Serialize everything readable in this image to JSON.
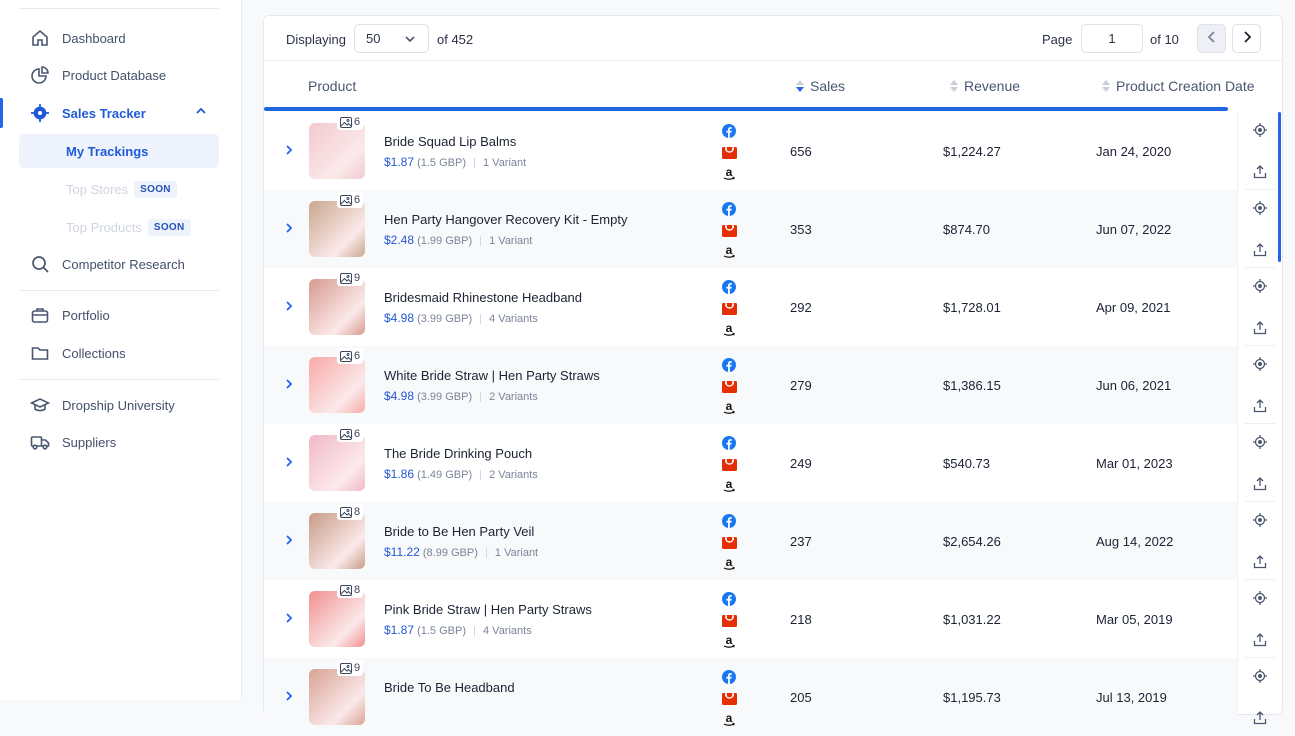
{
  "sidebar": {
    "items": [
      {
        "label": "Dashboard",
        "icon": "home-icon"
      },
      {
        "label": "Product Database",
        "icon": "pie-chart-icon"
      },
      {
        "label": "Sales Tracker",
        "icon": "crosshair-icon"
      },
      {
        "label": "Competitor Research",
        "icon": "search-icon"
      },
      {
        "label": "Portfolio",
        "icon": "briefcase-icon"
      },
      {
        "label": "Collections",
        "icon": "folder-icon"
      },
      {
        "label": "Dropship University",
        "icon": "graduation-cap-icon"
      },
      {
        "label": "Suppliers",
        "icon": "truck-icon"
      }
    ],
    "sub": [
      {
        "label": "My Trackings"
      },
      {
        "label": "Top Stores",
        "badge": "SOON"
      },
      {
        "label": "Top Products",
        "badge": "SOON"
      }
    ]
  },
  "toolbar": {
    "displaying_label": "Displaying",
    "page_size": "50",
    "of_total": "of 452",
    "page_label": "Page",
    "page_value": "1",
    "of_pages": "of 10"
  },
  "table": {
    "headers": {
      "product": "Product",
      "sales": "Sales",
      "revenue": "Revenue",
      "date": "Product Creation Date"
    },
    "rows": [
      {
        "name": "Bride Squad Lip Balms",
        "usd": "$1.87",
        "gbp": "(1.5 GBP)",
        "variants": "1 Variant",
        "images": "6",
        "sales": "656",
        "revenue": "$1,224.27",
        "date": "Jan 24, 2020",
        "thumb": "#f3c9cf"
      },
      {
        "name": "Hen Party Hangover Recovery Kit - Empty",
        "usd": "$2.48",
        "gbp": "(1.99 GBP)",
        "variants": "1 Variant",
        "images": "6",
        "sales": "353",
        "revenue": "$874.70",
        "date": "Jun 07, 2022",
        "thumb": "#c9a68c"
      },
      {
        "name": "Bridesmaid Rhinestone Headband",
        "usd": "$4.98",
        "gbp": "(3.99 GBP)",
        "variants": "4 Variants",
        "images": "9",
        "sales": "292",
        "revenue": "$1,728.01",
        "date": "Apr 09, 2021",
        "thumb": "#d79a8e"
      },
      {
        "name": "White Bride Straw | Hen Party Straws",
        "usd": "$4.98",
        "gbp": "(3.99 GBP)",
        "variants": "2 Variants",
        "images": "6",
        "sales": "279",
        "revenue": "$1,386.15",
        "date": "Jun 06, 2021",
        "thumb": "#f7a9a6"
      },
      {
        "name": "The Bride Drinking Pouch",
        "usd": "$1.86",
        "gbp": "(1.49 GBP)",
        "variants": "2 Variants",
        "images": "6",
        "sales": "249",
        "revenue": "$540.73",
        "date": "Mar 01, 2023",
        "thumb": "#f2b9c8"
      },
      {
        "name": "Bride to Be Hen Party Veil",
        "usd": "$11.22",
        "gbp": "(8.99 GBP)",
        "variants": "1 Variant",
        "images": "8",
        "sales": "237",
        "revenue": "$2,654.26",
        "date": "Aug 14, 2022",
        "thumb": "#c79b86"
      },
      {
        "name": "Pink Bride Straw | Hen Party Straws",
        "usd": "$1.87",
        "gbp": "(1.5 GBP)",
        "variants": "4 Variants",
        "images": "8",
        "sales": "218",
        "revenue": "$1,031.22",
        "date": "Mar 05, 2019",
        "thumb": "#f28f8f"
      },
      {
        "name": "Bride To Be Headband",
        "usd": "",
        "gbp": "",
        "variants": "",
        "images": "9",
        "sales": "205",
        "revenue": "$1,195.73",
        "date": "Jul 13, 2019",
        "thumb": "#d8a293"
      }
    ]
  },
  "colors": {
    "accent": "#2563eb",
    "facebook": "#1877f2",
    "aliexpress": "#e62e04",
    "amazon": "#111111"
  }
}
